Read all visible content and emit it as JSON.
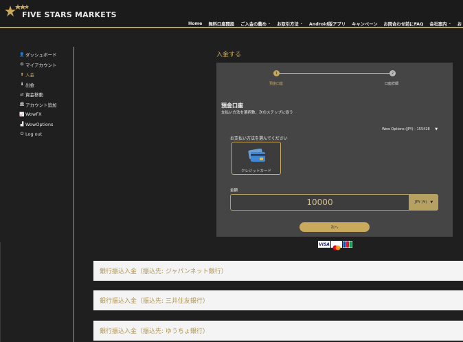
{
  "brand": {
    "name": "FIVE STARS MARKETS",
    "gold": "#c9a95c"
  },
  "nav": [
    {
      "label": "Home",
      "dropdown": false
    },
    {
      "label": "無料口座開設",
      "dropdown": false
    },
    {
      "label": "ご入金の薦め",
      "dropdown": true
    },
    {
      "label": "お取引方法",
      "dropdown": true
    },
    {
      "label": "Android版アプリ",
      "dropdown": false
    },
    {
      "label": "キャンペーン",
      "dropdown": false
    },
    {
      "label": "お問合わせ前にFAQ",
      "dropdown": false
    },
    {
      "label": "会社案内",
      "dropdown": true
    },
    {
      "label": "お",
      "dropdown": false
    }
  ],
  "sidebar": {
    "items": [
      {
        "label": "ダッシュボード",
        "icon": "user-icon",
        "glyph": "👤",
        "active": false
      },
      {
        "label": "マイアカウント",
        "icon": "gear-icon",
        "glyph": "⚙",
        "active": false
      },
      {
        "label": "入金",
        "icon": "deposit-icon",
        "glyph": "⬆",
        "active": true
      },
      {
        "label": "出金",
        "icon": "withdraw-icon",
        "glyph": "⬇",
        "active": false
      },
      {
        "label": "資金移動",
        "icon": "transfer-icon",
        "glyph": "⇄",
        "active": false
      },
      {
        "label": "アカウント追加",
        "icon": "bank-icon",
        "glyph": "🏛",
        "active": false
      },
      {
        "label": "WowFX",
        "icon": "chart-icon",
        "glyph": "📈",
        "active": false
      },
      {
        "label": "WowOptions",
        "icon": "area-chart-icon",
        "glyph": "▟",
        "active": false
      },
      {
        "label": "Log out",
        "icon": "power-icon",
        "glyph": "⏻",
        "active": false
      }
    ]
  },
  "main": {
    "title": "入金する",
    "steps": [
      {
        "number": "1",
        "label": "預金口座"
      },
      {
        "number": "2",
        "label": "口座詳細"
      }
    ],
    "section_title": "預金口座",
    "section_subtitle": "支払い方法を選択数、次のステップに従う",
    "account_select": "Wow Options (JPY) - 155428",
    "method_label": "お支払い方法を選んでください",
    "card_method": "クレジットカード",
    "amount_label": "金額",
    "amount_value": "10000",
    "currency": "JPY (¥)",
    "next_button": "次へ",
    "payment_logos": {
      "visa": "VISA",
      "jcb": "JCB"
    }
  },
  "banks": [
    "銀行振込入金（振込先: ジャパンネット銀行）",
    "銀行振込入金（振込先: 三井住友銀行）",
    "銀行振込入金（振込先: ゆうちょ銀行）"
  ]
}
